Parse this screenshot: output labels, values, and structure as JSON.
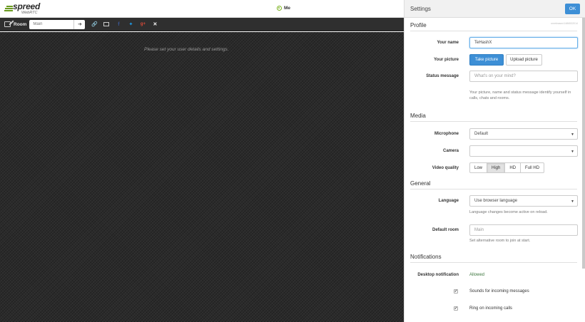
{
  "header": {
    "brand": "spreed",
    "brand_sub": "WebRTC",
    "user": "Me"
  },
  "room": {
    "label": "Room",
    "input_value": "Main",
    "enter_icon": "sign-in-icon",
    "share_icons": [
      "link-icon",
      "mail-icon",
      "facebook-icon",
      "twitter-icon",
      "google-plus-icon",
      "xing-icon"
    ]
  },
  "stage": {
    "hint": "Please set your user details and settings."
  },
  "settings": {
    "title": "Settings",
    "ok_label": "OK",
    "build": "unreleased.1486532014",
    "profile": {
      "heading": "Profile",
      "name_label": "Your name",
      "name_value": "TeHashX",
      "picture_label": "Your picture",
      "take_picture": "Take picture",
      "upload_picture": "Upload picture",
      "status_label": "Status message",
      "status_placeholder": "What's on your mind?",
      "help": "Your picture, name and status message identify yourself in calls, chats and rooms."
    },
    "media": {
      "heading": "Media",
      "microphone_label": "Microphone",
      "microphone_value": "Default",
      "camera_label": "Camera",
      "camera_value": "",
      "quality_label": "Video quality",
      "quality_options": [
        "Low",
        "High",
        "HD",
        "Full HD"
      ],
      "quality_selected": "High"
    },
    "general": {
      "heading": "General",
      "language_label": "Language",
      "language_value": "Use browser language",
      "language_help": "Language changes become active on reload.",
      "room_label": "Default room",
      "room_placeholder": "Main",
      "room_help": "Set alternative room to join at start."
    },
    "notifications": {
      "heading": "Notifications",
      "desktop_label": "Desktop notification",
      "desktop_value": "Allowed",
      "sounds_label": "Sounds for incoming messages",
      "sounds_checked": true,
      "ring_label": "Ring on incoming calls",
      "ring_checked": true
    }
  },
  "colors": {
    "primary": "#3d8fd6",
    "brand_green": "#6a9a1f",
    "online": "#7bb21f",
    "allowed": "#3c763d",
    "stage_bg": "#2b2b2b"
  }
}
